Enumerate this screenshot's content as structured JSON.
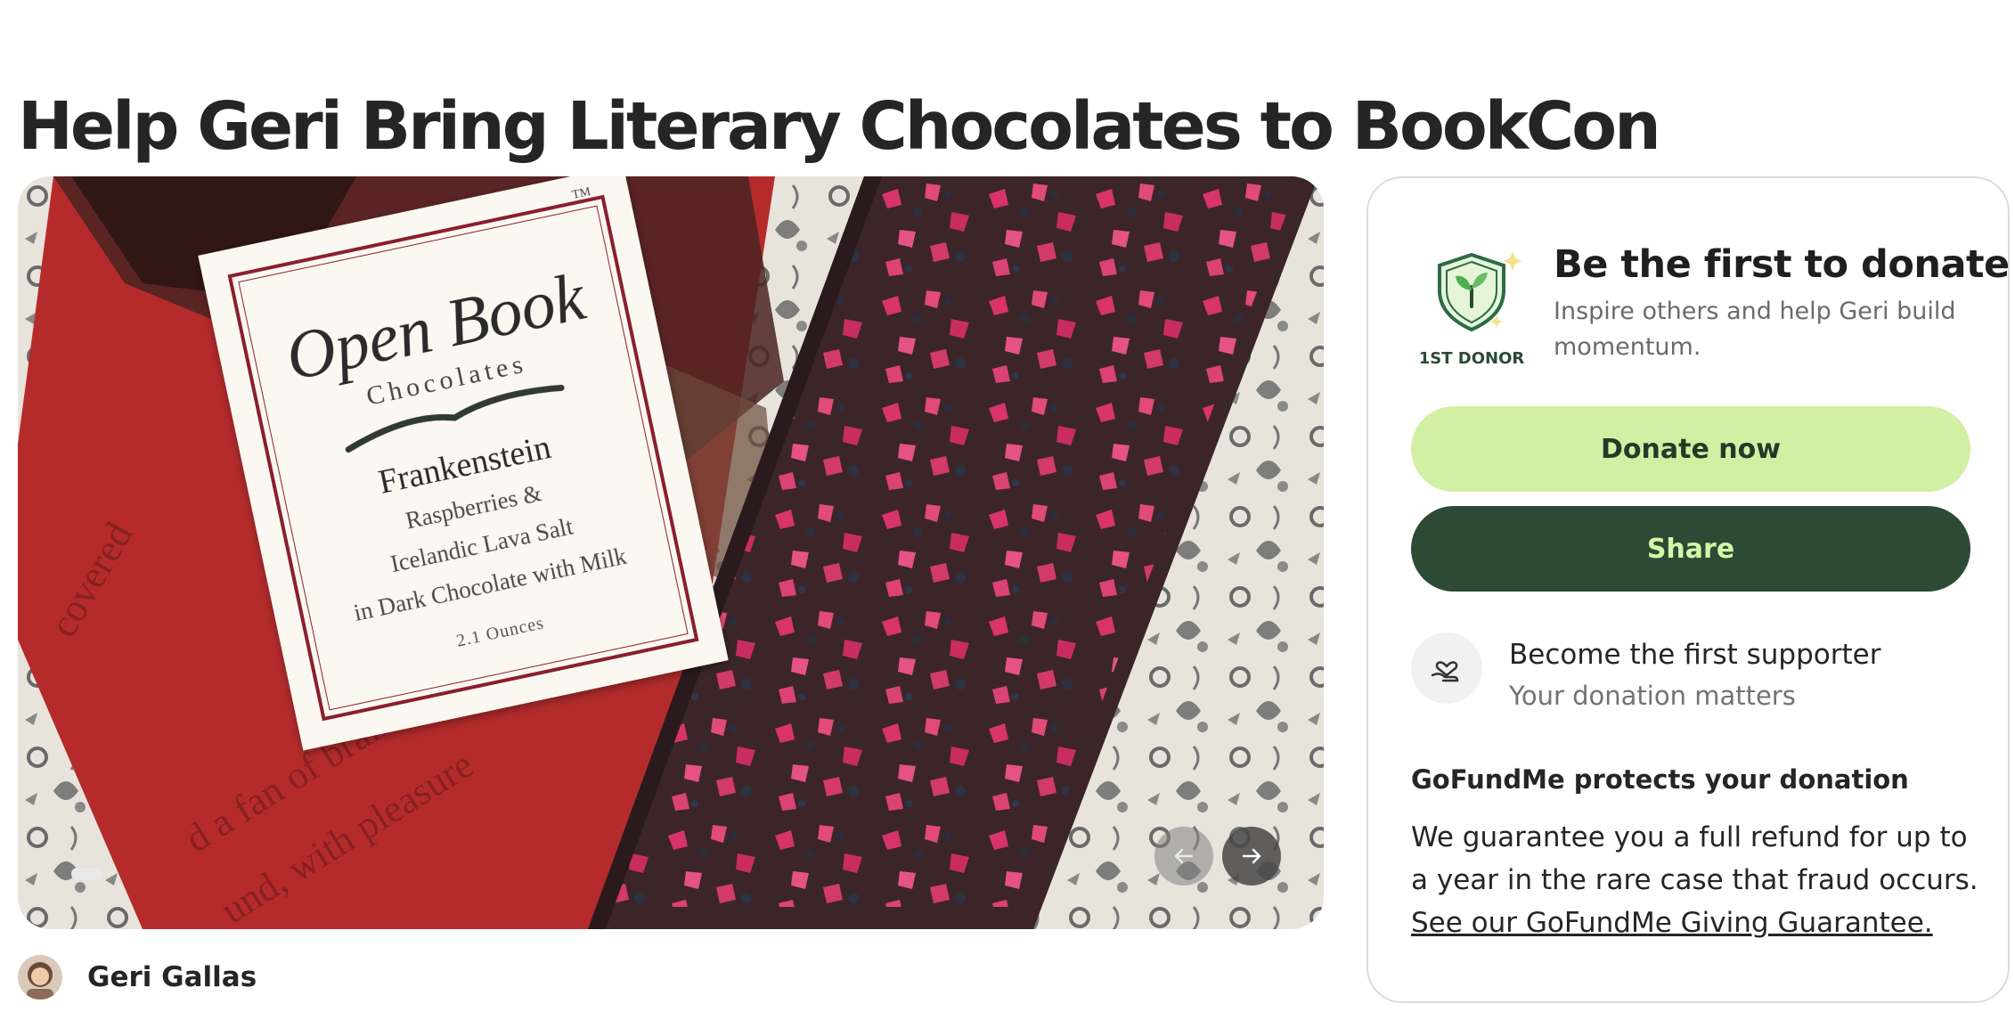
{
  "campaign": {
    "title": "Help Geri Bring Literary Chocolates to BookCon",
    "organizer_name": "Geri Gallas"
  },
  "hero_label": {
    "trademark": "TM",
    "brand": "Open Book",
    "brand_sub": "Chocolates",
    "product": "Frankenstein",
    "desc_1": "Raspberries &",
    "desc_2": "Icelandic Lava Salt",
    "desc_3": "in Dark Chocolate with Milk",
    "weight": "2.1 Ounces"
  },
  "carousel": {
    "prev_icon": "arrow-left-icon",
    "next_icon": "arrow-right-icon"
  },
  "donate_panel": {
    "badge_label": "1ST DONOR",
    "first_title": "Be the first to donate",
    "first_subtitle": "Inspire others and help Geri build momentum.",
    "donate_label": "Donate now",
    "share_label": "Share",
    "supporter_title": "Become the first supporter",
    "supporter_subtitle": "Your donation matters",
    "protect_title": "GoFundMe protects your donation",
    "protect_body": "We guarantee you a full refund for up to a year in the rare case that fraud occurs.",
    "protect_link": "See our GoFundMe Giving Guarantee."
  },
  "colors": {
    "donate_button": "#d1f0a3",
    "share_button": "#2d4a34",
    "share_text": "#d6f5a8",
    "badge_green": "#2b4a35"
  }
}
